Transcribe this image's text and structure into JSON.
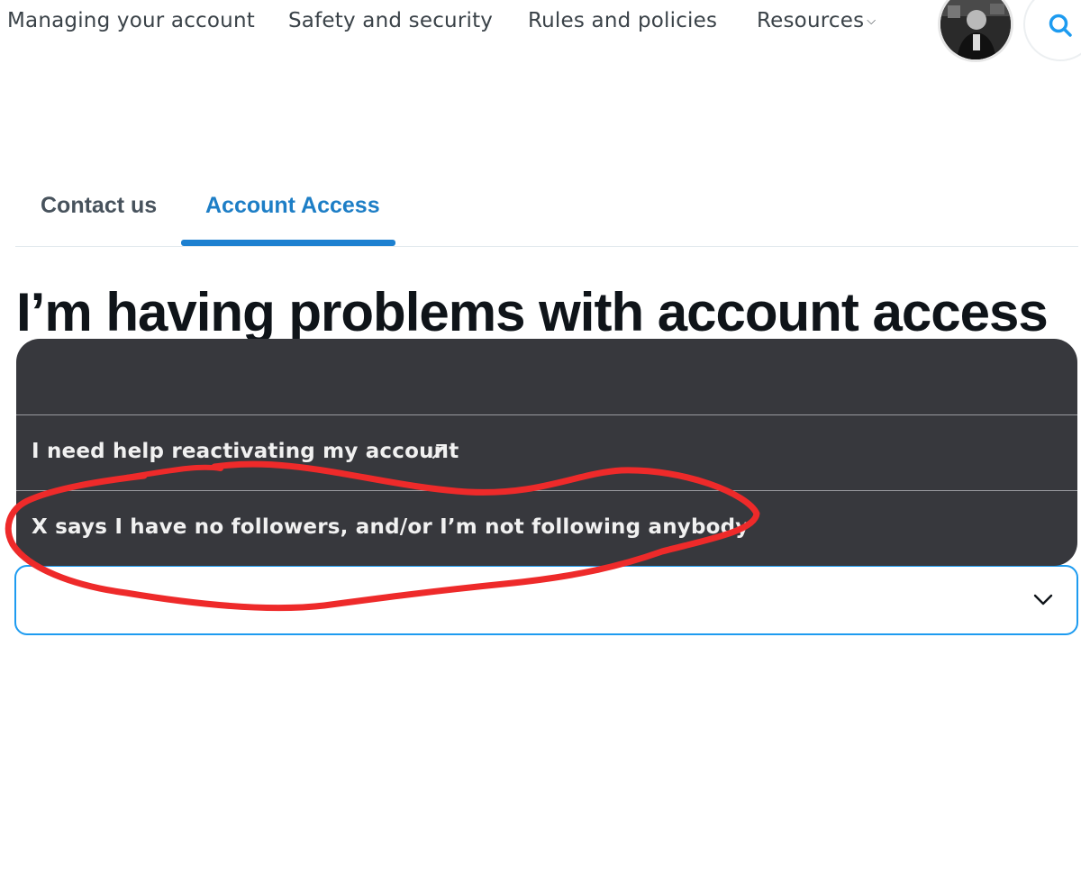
{
  "nav": {
    "items": [
      {
        "label": "Managing your account"
      },
      {
        "label": "Safety and security"
      },
      {
        "label": "Rules and policies"
      },
      {
        "label": "Resources",
        "icon": "chevron-down-icon"
      }
    ],
    "avatar_icon": "user-avatar",
    "search_icon": "search-icon"
  },
  "tabs": [
    {
      "label": "Contact us",
      "active": false
    },
    {
      "label": "Account Access",
      "active": true
    }
  ],
  "page": {
    "title": "I’m having problems with account access"
  },
  "dropdown": {
    "options": [
      {
        "label": ""
      },
      {
        "label": "I need help reactivating my account",
        "icon": "external-link-icon"
      },
      {
        "label": "X says I have no followers, and/or I’m not following anybody"
      }
    ]
  },
  "select": {
    "value": "",
    "icon": "chevron-down-icon"
  },
  "colors": {
    "accent": "#1d9bf0",
    "tab_active": "#1d7ec6",
    "dropdown_bg": "#37383d",
    "annotation": "#ee2a2a"
  }
}
